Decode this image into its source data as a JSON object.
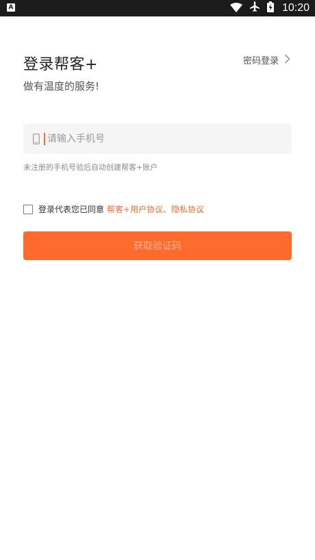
{
  "status_bar": {
    "left_icon_letter": "A",
    "time": "10:20",
    "icons": [
      "wifi-icon",
      "airplane-icon",
      "battery-icon"
    ]
  },
  "header": {
    "title": "登录帮客+",
    "subtitle": "做有温度的服务!",
    "password_login_label": "密码登录"
  },
  "form": {
    "phone_placeholder": "请输入手机号",
    "phone_value": "",
    "hint": "未注册的手机号验后自动创建帮客+账户",
    "agree_prefix": "登录代表您已同意",
    "agree_link": "帮客+用户协议、隐私协议",
    "agree_checked": false,
    "submit_label": "获取验证码"
  },
  "colors": {
    "accent": "#ff6b2c",
    "status_bar_bg": "#1b1b1b",
    "input_bg": "#f5f5f5"
  }
}
